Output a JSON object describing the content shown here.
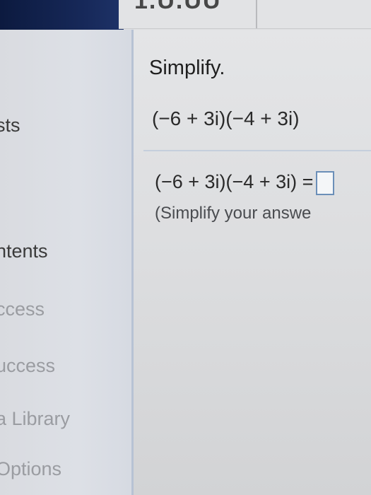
{
  "header": {
    "title_partial": "1.U.UU"
  },
  "sidebar": {
    "items": [
      {
        "label": "sts"
      },
      {
        "label": "ntents"
      },
      {
        "label": "ccess"
      },
      {
        "label": "uccess"
      },
      {
        "label": "a Library"
      },
      {
        "label": "Options"
      }
    ]
  },
  "question": {
    "instruction": "Simplify.",
    "expression": "(−6 + 3i)(−4 + 3i)",
    "answer_prefix": "(−6 + 3i)(−4 + 3i) =",
    "answer_value": "",
    "hint": "(Simplify your answe"
  }
}
